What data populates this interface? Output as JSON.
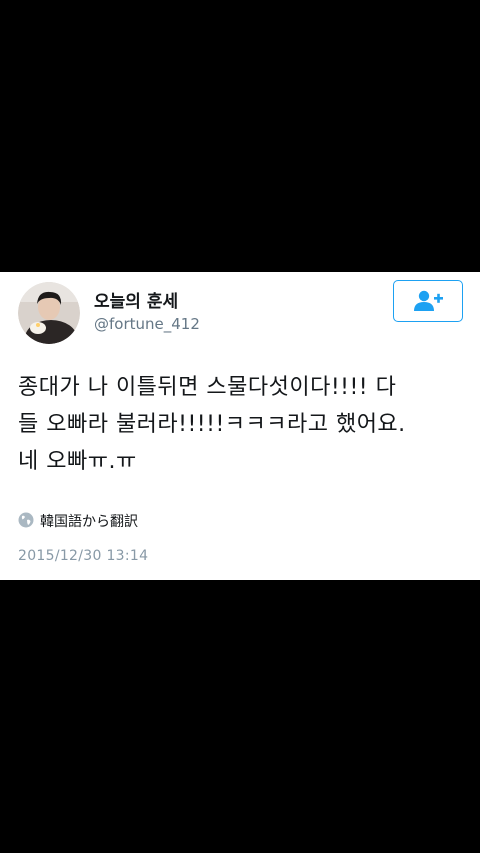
{
  "tweet": {
    "user": {
      "display_name": "오늘의 훈세",
      "handle": "@fortune_412",
      "avatar_icon": "user-avatar-photo"
    },
    "follow_button": {
      "icon": "add-user-icon",
      "accent_color": "#1da1f2"
    },
    "text_lines": [
      "종대가 나 이틀뒤면 스물다섯이다!!!! 다",
      "들 오빠라 불러라!!!!!ㅋㅋㅋ라고 했어요.",
      "네 오빠ㅠ.ㅠ"
    ],
    "translate": {
      "icon": "globe-icon",
      "label": "韓国語から翻訳"
    },
    "timestamp": "2015/12/30 13:14"
  }
}
